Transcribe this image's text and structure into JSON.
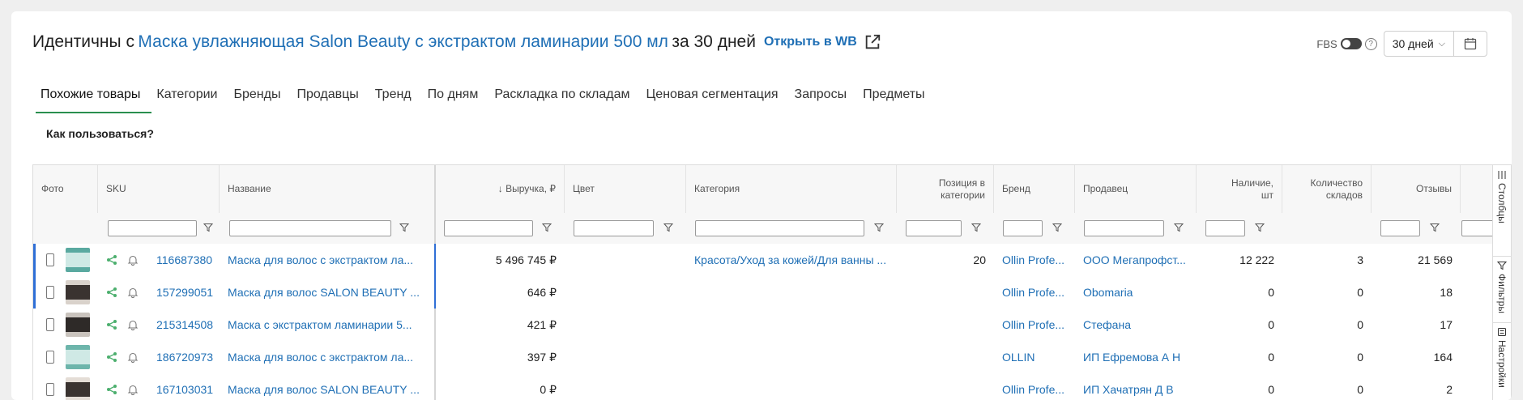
{
  "header": {
    "title_prefix": "Идентичны с",
    "product_link": "Маска увлажняющая Salon Beauty с экстрактом ламинарии 500 мл",
    "title_suffix": "за 30 дней",
    "open_wb": "Открыть в WB",
    "fbs_label": "FBS",
    "help_icon": "?",
    "period_value": "30 дней"
  },
  "tabs": [
    {
      "label": "Похожие товары",
      "active": true
    },
    {
      "label": "Категории"
    },
    {
      "label": "Бренды"
    },
    {
      "label": "Продавцы"
    },
    {
      "label": "Тренд"
    },
    {
      "label": "По дням"
    },
    {
      "label": "Раскладка по складам"
    },
    {
      "label": "Ценовая сегментация"
    },
    {
      "label": "Запросы"
    },
    {
      "label": "Предметы"
    }
  ],
  "howto": "Как пользоваться?",
  "table": {
    "columns": {
      "photo": "Фото",
      "sku": "SKU",
      "name": "Название",
      "revenue": "↓ Выручка, ₽",
      "color": "Цвет",
      "category": "Категория",
      "position_1": "Позиция в",
      "position_2": "категории",
      "brand": "Бренд",
      "seller": "Продавец",
      "stock_1": "Наличие,",
      "stock_2": "шт",
      "warehouses_1": "Количество",
      "warehouses_2": "складов",
      "reviews": "Отзывы",
      "rating_partial": "Р"
    },
    "rows": [
      {
        "sku": "116687380",
        "name": "Маска для волос с экстрактом ла...",
        "revenue": "5 496 745 ₽",
        "category": "Красота/Уход за кожей/Для ванны ...",
        "position": "20",
        "brand": "Ollin Profe...",
        "seller": "ООО Мегапрофст...",
        "stock": "12 222",
        "warehouses": "3",
        "reviews": "21 569",
        "selected": true
      },
      {
        "sku": "157299051",
        "name": "Маска для волос SALON BEAUTY ...",
        "revenue": "646 ₽",
        "category": "",
        "position": "",
        "brand": "Ollin Profe...",
        "seller": "Obomaria",
        "stock": "0",
        "warehouses": "0",
        "reviews": "18",
        "selected": true
      },
      {
        "sku": "215314508",
        "name": "Маска с экстрактом ламинарии 5...",
        "revenue": "421 ₽",
        "category": "",
        "position": "",
        "brand": "Ollin Profe...",
        "seller": "Стефана",
        "stock": "0",
        "warehouses": "0",
        "reviews": "17",
        "selected": false
      },
      {
        "sku": "186720973",
        "name": "Маска для волос с экстрактом ла...",
        "revenue": "397 ₽",
        "category": "",
        "position": "",
        "brand": "OLLIN",
        "seller": "ИП Ефремова А Н",
        "stock": "0",
        "warehouses": "0",
        "reviews": "164",
        "selected": false
      },
      {
        "sku": "167103031",
        "name": "Маска для волос SALON BEAUTY ...",
        "revenue": "0 ₽",
        "category": "",
        "position": "",
        "brand": "Ollin Profe...",
        "seller": "ИП Хачатрян Д В",
        "stock": "0",
        "warehouses": "0",
        "reviews": "2",
        "selected": false
      }
    ]
  },
  "sidebar": {
    "columns": "Столбцы",
    "filters": "Фильтры",
    "settings": "Настройки"
  }
}
